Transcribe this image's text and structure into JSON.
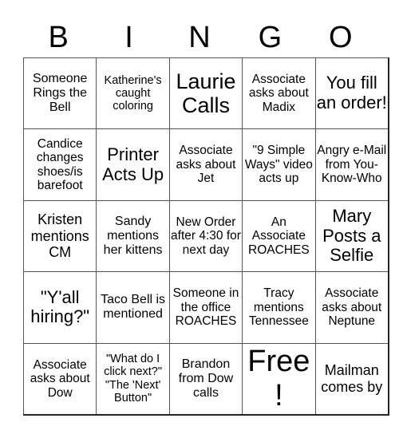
{
  "header": {
    "letters": [
      "B",
      "I",
      "N",
      "G",
      "O"
    ]
  },
  "board": {
    "rows": [
      [
        "Someone Rings the Bell",
        "Katherine's caught coloring",
        "Laurie Calls",
        "Associate asks about Madix",
        "You fill an order!"
      ],
      [
        "Candice changes shoes/is barefoot",
        "Printer Acts Up",
        "Associate asks about Jet",
        "\"9 Simple Ways\" video acts up",
        "Angry e-Mail from You-Know-Who"
      ],
      [
        "Kristen mentions CM",
        "Sandy mentions her kittens",
        "New Order after 4:30 for next day",
        "An Associate ROACHES",
        "Mary Posts a Selfie"
      ],
      [
        "\"Y'all hiring?\"",
        "Taco Bell is mentioned",
        "Someone in the office ROACHES",
        "Tracy mentions Tennessee",
        "Associate asks about Neptune"
      ],
      [
        "Associate asks about Dow",
        "\"What do I click next?\" \"The 'Next' Button\"",
        "Brandon from Dow calls",
        "Free!",
        "Mailman comes by"
      ]
    ]
  }
}
